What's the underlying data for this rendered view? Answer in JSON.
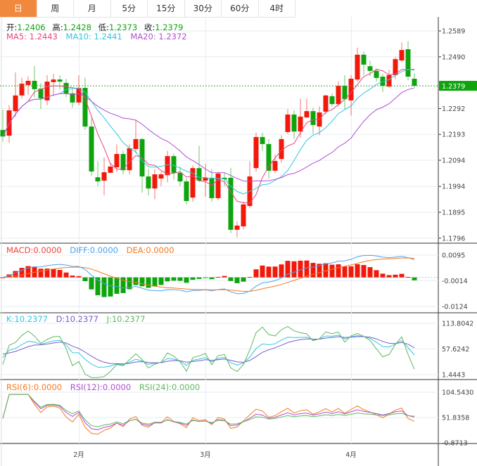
{
  "tabs": [
    {
      "label": "日",
      "active": true
    },
    {
      "label": "周"
    },
    {
      "label": "月"
    },
    {
      "label": "5分"
    },
    {
      "label": "15分"
    },
    {
      "label": "30分"
    },
    {
      "label": "60分"
    },
    {
      "label": "4时"
    }
  ],
  "ohlc_legend": {
    "open_label": "开:",
    "open": "1.2406",
    "high_label": "高:",
    "high": "1.2428",
    "low_label": "低:",
    "low": "1.2373",
    "close_label": "收:",
    "close": "1.2379"
  },
  "ma_legend": {
    "ma5": "MA5: 1.2443",
    "ma10": "MA10: 1.2441",
    "ma20": "MA20: 1.2372"
  },
  "macd_legend": {
    "macd": "MACD:0.0000",
    "diff": "DIFF:0.0000",
    "dea": "DEA:0.0000"
  },
  "kdj_legend": {
    "k": "K:10.2377",
    "d": "D:10.2377",
    "j": "J:10.2377"
  },
  "rsi_legend": {
    "rsi6": "RSI(6):0.0000",
    "rsi12": "RSI(12):0.0000",
    "rsi24": "RSI(24):0.0000"
  },
  "colors": {
    "up": "#f2190b",
    "down": "#0ea40e",
    "ma5": "#e8457e",
    "ma10": "#31c5e0",
    "ma20": "#b04fcf",
    "diff": "#4aa3f0",
    "dea": "#f57a20",
    "k": "#31c5e0",
    "d": "#7b5cc7",
    "j": "#5fb85f",
    "rsi6": "#f57a20",
    "rsi12": "#b04fcf",
    "rsi24": "#5fb85f",
    "active_tab": "#f0883e"
  },
  "chart_data": {
    "type": "candlestick",
    "last_price": "1.2379",
    "price_ticks": [
      "1.2589",
      "1.2490",
      "1.2292",
      "1.2193",
      "1.2094",
      "1.1994",
      "1.1895",
      "1.1796"
    ],
    "macd_ticks": [
      "0.0095",
      "-0.0014",
      "-0.0124"
    ],
    "kdj_ticks": [
      "113.8042",
      "57.6242",
      "1.4443"
    ],
    "rsi_ticks": [
      "104.5430",
      "51.8358",
      "-0.8713"
    ],
    "month_labels": [
      {
        "label": "2月",
        "index": 12
      },
      {
        "label": "3月",
        "index": 32
      },
      {
        "label": "4月",
        "index": 55
      }
    ],
    "open": [
      1.221,
      1.2188,
      1.2282,
      1.2342,
      1.2382,
      1.2398,
      1.2368,
      1.2323,
      1.2393,
      1.2403,
      1.239,
      1.235,
      1.2315,
      1.2371,
      1.2223,
      1.2029,
      1.2016,
      1.2046,
      1.2067,
      1.2118,
      1.2056,
      1.2137,
      1.2175,
      1.2032,
      1.1986,
      1.2024,
      1.2037,
      1.211,
      1.2046,
      1.2013,
      1.1951,
      1.2064,
      1.2016,
      1.2027,
      1.1949,
      1.2027,
      1.2027,
      1.1828,
      1.1841,
      1.1919,
      1.2064,
      1.2183,
      1.2156,
      1.2054,
      1.2099,
      1.2202,
      1.2269,
      1.2204,
      1.2258,
      1.2282,
      1.2223,
      1.228,
      1.2339,
      1.2309,
      1.2379,
      1.2323,
      1.2403,
      1.2498,
      1.2454,
      1.2436,
      1.2414,
      1.2376,
      1.242,
      1.2476,
      1.2519,
      1.2406
    ],
    "high": [
      1.2288,
      1.2305,
      1.243,
      1.241,
      1.2415,
      1.2455,
      1.239,
      1.242,
      1.2425,
      1.242,
      1.2405,
      1.2365,
      1.242,
      1.241,
      1.2255,
      1.209,
      1.2105,
      1.2085,
      1.2155,
      1.213,
      1.2155,
      1.225,
      1.218,
      1.206,
      1.206,
      1.205,
      1.213,
      1.212,
      1.207,
      1.2025,
      1.2075,
      1.215,
      1.208,
      1.206,
      1.205,
      1.2045,
      1.2065,
      1.186,
      1.1935,
      1.209,
      1.22,
      1.22,
      1.2175,
      1.2115,
      1.219,
      1.229,
      1.2285,
      1.233,
      1.233,
      1.2295,
      1.23,
      1.2345,
      1.235,
      1.2395,
      1.242,
      1.242,
      1.2525,
      1.251,
      1.2475,
      1.2445,
      1.2425,
      1.244,
      1.249,
      1.2545,
      1.255,
      1.2428
    ],
    "low": [
      1.2165,
      1.216,
      1.226,
      1.233,
      1.2345,
      1.2335,
      1.229,
      1.2305,
      1.234,
      1.2365,
      1.2335,
      1.2295,
      1.2305,
      1.221,
      1.2035,
      1.1995,
      1.196,
      1.205,
      1.205,
      1.204,
      1.204,
      1.212,
      1.197,
      1.196,
      1.1945,
      1.1995,
      1.201,
      1.202,
      1.1995,
      1.1925,
      1.1935,
      1.201,
      1.1955,
      1.1935,
      1.194,
      1.1995,
      1.1815,
      1.18,
      1.183,
      1.191,
      1.205,
      1.213,
      1.2025,
      1.2045,
      1.2085,
      1.2195,
      1.2175,
      1.218,
      1.2255,
      1.2195,
      1.219,
      1.227,
      1.23,
      1.23,
      1.229,
      1.2265,
      1.2395,
      1.242,
      1.2415,
      1.2395,
      1.2355,
      1.237,
      1.2405,
      1.247,
      1.24,
      1.2373
    ],
    "close": [
      1.2185,
      1.2285,
      1.2342,
      1.2387,
      1.2398,
      1.2366,
      1.2331,
      1.2395,
      1.2403,
      1.2395,
      1.235,
      1.2315,
      1.2371,
      1.2223,
      1.2051,
      1.2013,
      1.2048,
      1.207,
      1.2118,
      1.2056,
      1.214,
      1.2175,
      1.2032,
      1.1986,
      1.204,
      1.204,
      1.211,
      1.2046,
      1.2013,
      1.1938,
      1.2064,
      1.2016,
      1.2027,
      1.1949,
      1.2043,
      1.2021,
      1.1828,
      1.1844,
      1.1925,
      1.2032,
      1.2183,
      1.2156,
      1.2054,
      1.2091,
      1.2175,
      1.2269,
      1.2204,
      1.2261,
      1.2282,
      1.2229,
      1.2277,
      1.2342,
      1.2309,
      1.2379,
      1.2328,
      1.2406,
      1.2498,
      1.246,
      1.2436,
      1.2409,
      1.2379,
      1.242,
      1.2481,
      1.2516,
      1.2414,
      1.2379
    ]
  }
}
